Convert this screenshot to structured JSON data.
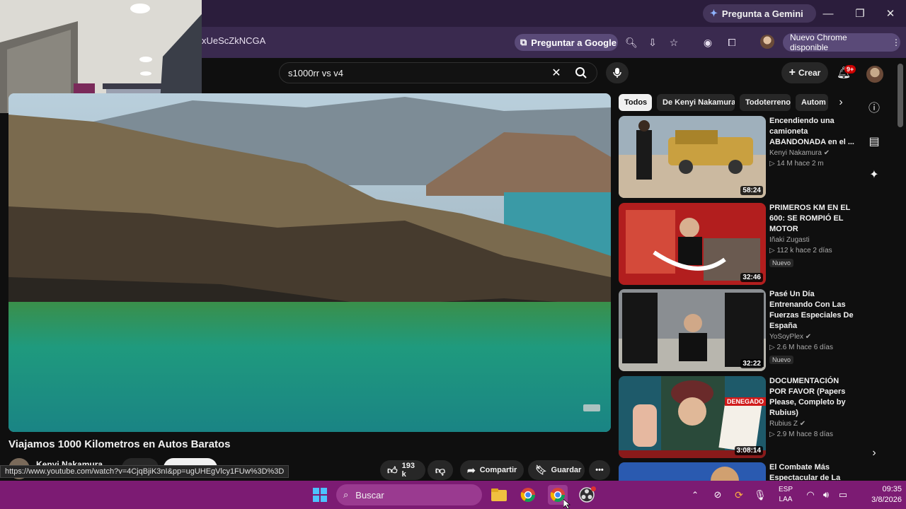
{
  "browser": {
    "gemini_label": "Pregunta a Gemini",
    "url_fragment": "xUeScZkNCGA",
    "ask_google_label": "Preguntar a Google",
    "update_label": "Nuevo Chrome disponible",
    "status_url": "https://www.youtube.com/watch?v=4CjqBjiK3nI&pp=ugUHEgVlcy1FUw%3D%3D"
  },
  "youtube": {
    "search_query": "s1000rr vs v4",
    "create_label": "Crear",
    "notif_count": "9+",
    "video": {
      "title": "Viajamos 1000 Kilometros en Autos Baratos",
      "channel": "Kenyi Nakamura",
      "likes": "193 k",
      "share_label": "Compartir",
      "save_label": "Guardar"
    },
    "chips": [
      "Todos",
      "De Kenyi Nakamura",
      "Todoterreno",
      "Autom"
    ],
    "recommendations": [
      {
        "title": "Encendiendo una camioneta ABANDONADA en el ...",
        "channel": "Kenyi Nakamura",
        "meta": "▷ 14 M   hace 2 m",
        "duration": "58:24",
        "badge": ""
      },
      {
        "title": "PRIMEROS KM EN EL 600: SE ROMPIÓ EL MOTOR",
        "channel": "Iñaki Zugasti",
        "meta": "▷ 112 k   hace 2 días",
        "duration": "32:46",
        "badge": "Nuevo"
      },
      {
        "title": "Pasé Un Día Entrenando Con Las Fuerzas Especiales De España",
        "channel": "YoSoyPlex",
        "meta": "▷ 2.6 M   hace 6 días",
        "duration": "32:22",
        "badge": "Nuevo"
      },
      {
        "title": "DOCUMENTACIÓN POR FAVOR (Papers Please, Completo by Rubius)",
        "channel": "Rubius Z",
        "meta": "▷ 2.9 M   hace 8 días",
        "duration": "3:08:14",
        "badge": ""
      },
      {
        "title": "El Combate Más Espectacular de La",
        "channel": "",
        "meta": "",
        "duration": "",
        "badge": ""
      }
    ],
    "thumb_text": "DENEGADO"
  },
  "taskbar": {
    "search_placeholder": "Buscar",
    "lang_line1": "ESP",
    "lang_line2": "LAA",
    "time": "09:35",
    "date": "3/8/2026"
  }
}
